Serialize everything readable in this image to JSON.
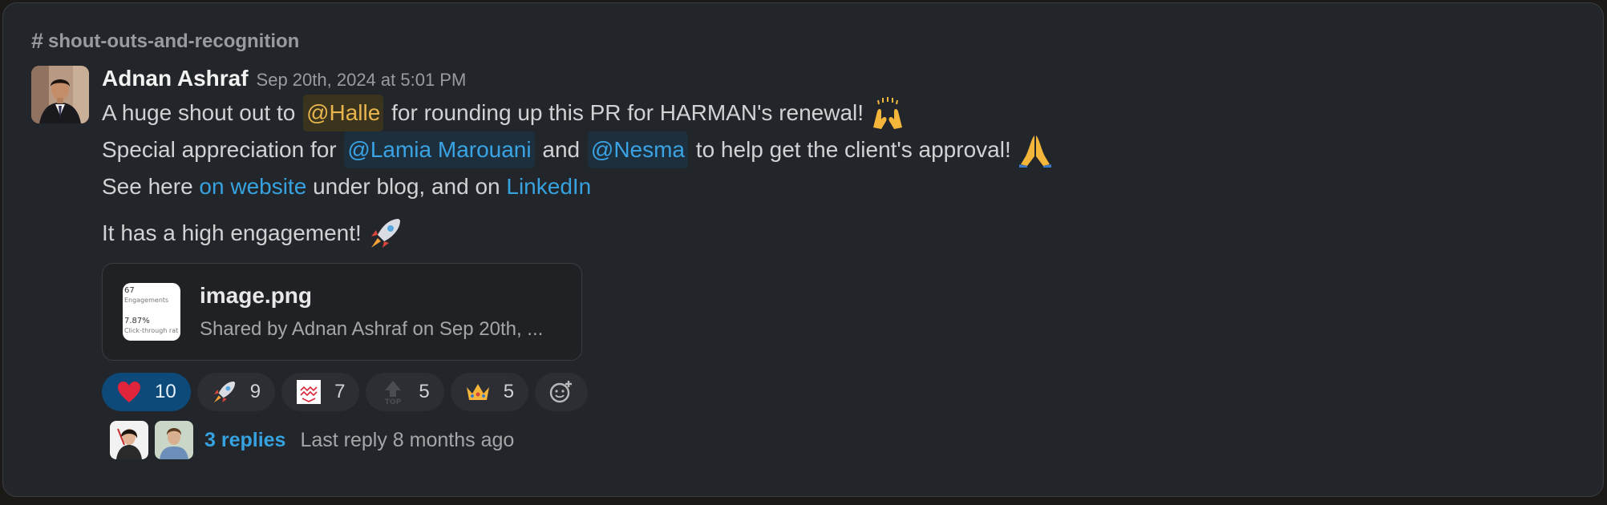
{
  "channel": {
    "name": "shout-outs-and-recognition",
    "icon": "hash-icon"
  },
  "message": {
    "author": "Adnan Ashraf",
    "timestamp": "Sep 20th, 2024 at 5:01 PM",
    "line1": {
      "before": "A huge shout out to ",
      "mention": "@Halle",
      "after": " for rounding up this PR for HARMAN's renewal!",
      "emoji": "raised-hands-emoji"
    },
    "line2": {
      "before": "Special appreciation for ",
      "mention1": "@Lamia Marouani",
      "middle": " and ",
      "mention2": "@Nesma",
      "after": " to help get the client's approval!",
      "emoji": "folded-hands-emoji"
    },
    "line3": {
      "before": "See here ",
      "link1": "on website",
      "middle": " under blog, and on ",
      "link2": "LinkedIn"
    },
    "line4": {
      "text": "It has a high engagement!",
      "emoji": "rocket-emoji"
    }
  },
  "attachment": {
    "name": "image.png",
    "subtitle": "Shared by Adnan Ashraf on Sep 20th, ...",
    "thumb": {
      "line1": "67",
      "line2": "Engagements",
      "line3": "7.87%",
      "line4": "Click-through rat"
    }
  },
  "reactions": [
    {
      "icon": "heart-emoji",
      "count": "10",
      "active": true
    },
    {
      "icon": "rocket-emoji",
      "count": "9"
    },
    {
      "icon": "love-letter-emoji",
      "count": "7"
    },
    {
      "icon": "top-arrow-emoji",
      "count": "5"
    },
    {
      "icon": "crown-emoji",
      "count": "5"
    }
  ],
  "add_reaction": {
    "icon": "add-reaction-icon"
  },
  "thread": {
    "replies": "3 replies",
    "last_reply": "Last reply 8 months ago"
  },
  "colors": {
    "background": "#222529",
    "mention": "#3aa3e3",
    "self_mention": "#e8b54c",
    "link": "#36a3e0",
    "active_reaction": "#0e4a79"
  }
}
